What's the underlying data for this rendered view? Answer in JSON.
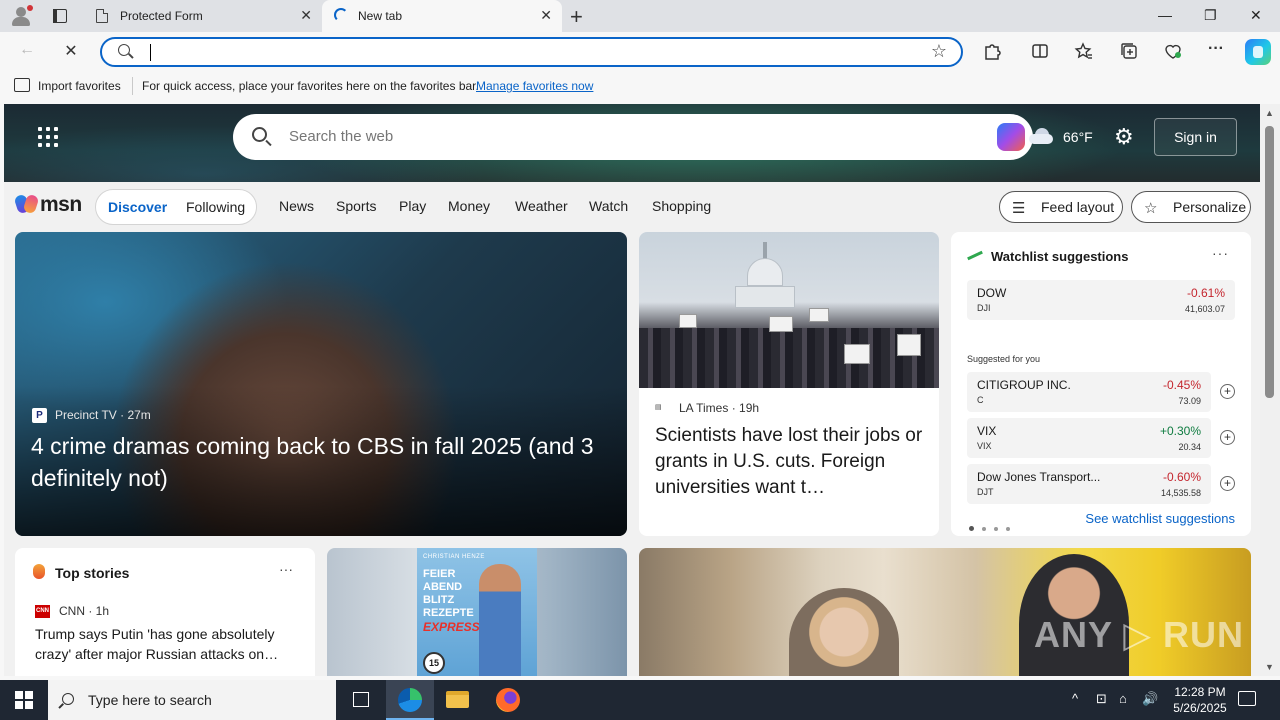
{
  "browser": {
    "tabs": [
      {
        "title": "Protected Form",
        "close": "✕"
      },
      {
        "title": "New tab",
        "close": "✕"
      }
    ],
    "new_tab_symbol": "+",
    "window_controls": {
      "minimize": "—",
      "restore": "❐",
      "close": "✕"
    },
    "toolbar": {
      "back_symbol": "←",
      "stop_symbol": "✕",
      "address_value": "",
      "favorite_symbol": "☆",
      "icons": [
        "extensions-icon",
        "split-screen-icon",
        "favorites-icon",
        "collections-icon",
        "browser-essentials-icon",
        "more-icon",
        "copilot-icon"
      ],
      "more_symbol": "···"
    },
    "favorites_bar": {
      "import_label": "Import favorites",
      "message": "For quick access, place your favorites here on the favorites bar.",
      "link": "Manage favorites now"
    }
  },
  "msn": {
    "search_placeholder": "Search the web",
    "temperature": "66°F",
    "settings_symbol": "⚙",
    "sign_in": "Sign in",
    "logo_text": "msn",
    "feed_tabs": {
      "active": "Discover",
      "other": "Following"
    },
    "nav_links": [
      "News",
      "Sports",
      "Play",
      "Money",
      "Weather",
      "Watch",
      "Shopping"
    ],
    "feed_layout": "Feed layout",
    "personalize": "Personalize",
    "hero": {
      "source": "Precinct TV",
      "time": "27m",
      "source_meta": "Precinct TV · 27m",
      "title": "4 crime dramas coming back to CBS in fall 2025 (and 3 definitely not)"
    },
    "news": {
      "source_meta": "LA Times · 19h",
      "title": "Scientists have lost their jobs or grants in U.S. cuts. Foreign universities want t…"
    },
    "watchlist": {
      "title": "Watchlist suggestions",
      "more": "···",
      "suggested_label": "Suggested for you",
      "link": "See watchlist suggestions",
      "items": [
        {
          "name": "DOW",
          "symbol": "DJI",
          "change": "-0.61%",
          "price": "41,603.07",
          "direction": "down"
        },
        {
          "name": "CITIGROUP INC.",
          "symbol": "C",
          "change": "-0.45%",
          "price": "73.09",
          "direction": "down"
        },
        {
          "name": "VIX",
          "symbol": "VIX",
          "change": "+0.30%",
          "price": "20.34",
          "direction": "up"
        },
        {
          "name": "Dow Jones Transport...",
          "symbol": "DJT",
          "change": "-0.60%",
          "price": "14,535.58",
          "direction": "down"
        }
      ],
      "add_symbol": "+"
    },
    "top_stories": {
      "title": "Top stories",
      "more": "···",
      "cnn_logo": "CNN",
      "source_meta": "CNN · 1h",
      "headline": "Trump says Putin 'has gone absolutely crazy' after major Russian attacks on…"
    },
    "book": {
      "author": "CHRISTIAN HENZE",
      "title_lines": "FEIER\nABEND\nBLITZ\nREZEPTE",
      "subtitle": "EXPRESS",
      "badge": "15"
    },
    "watermark": "ANY RUN"
  },
  "taskbar": {
    "search_placeholder": "Type here to search",
    "time": "12:28 PM",
    "date": "5/26/2025",
    "tray_symbols": [
      "^",
      "⊡",
      "⌂",
      "🔊"
    ]
  },
  "colors": {
    "accent": "#0a64c8",
    "negative": "#c4262e",
    "positive": "#107c41",
    "taskbar": "#1f2733"
  }
}
